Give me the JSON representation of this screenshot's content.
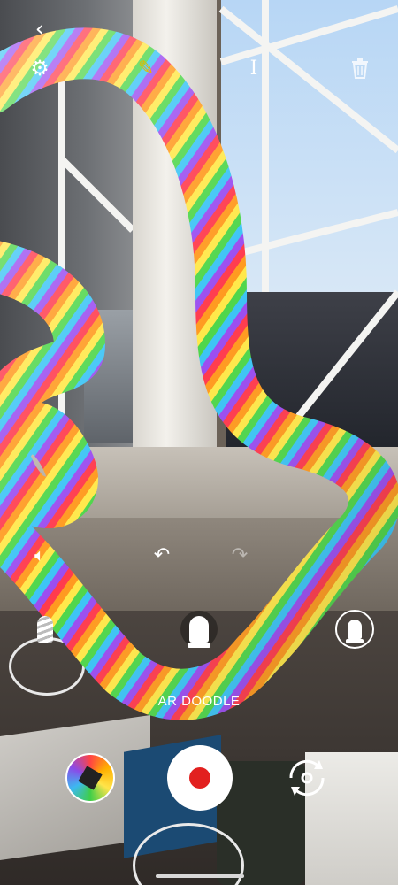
{
  "top_bar": {
    "back_icon": "chevron-left-icon",
    "settings_icon": "gear-icon",
    "pen_icon": "pen-icon",
    "text_icon": "text-cursor-icon",
    "delete_icon": "trash-icon",
    "pen_color": "#e8b400"
  },
  "edit_bar": {
    "sound_icon": "speaker-icon",
    "undo_icon": "undo-icon",
    "redo_icon": "redo-icon"
  },
  "brushes": [
    {
      "icon": "twisted-brush-icon"
    },
    {
      "icon": "brush-tip-icon",
      "selected": true
    },
    {
      "icon": "brush-tip-outline-icon"
    }
  ],
  "mode": {
    "label": "AR DOODLE"
  },
  "bottom_bar": {
    "gallery_icon": "gallery-thumbnail",
    "record_icon": "record-icon",
    "record_color": "#e2201f",
    "switch_camera_icon": "switch-camera-icon"
  }
}
